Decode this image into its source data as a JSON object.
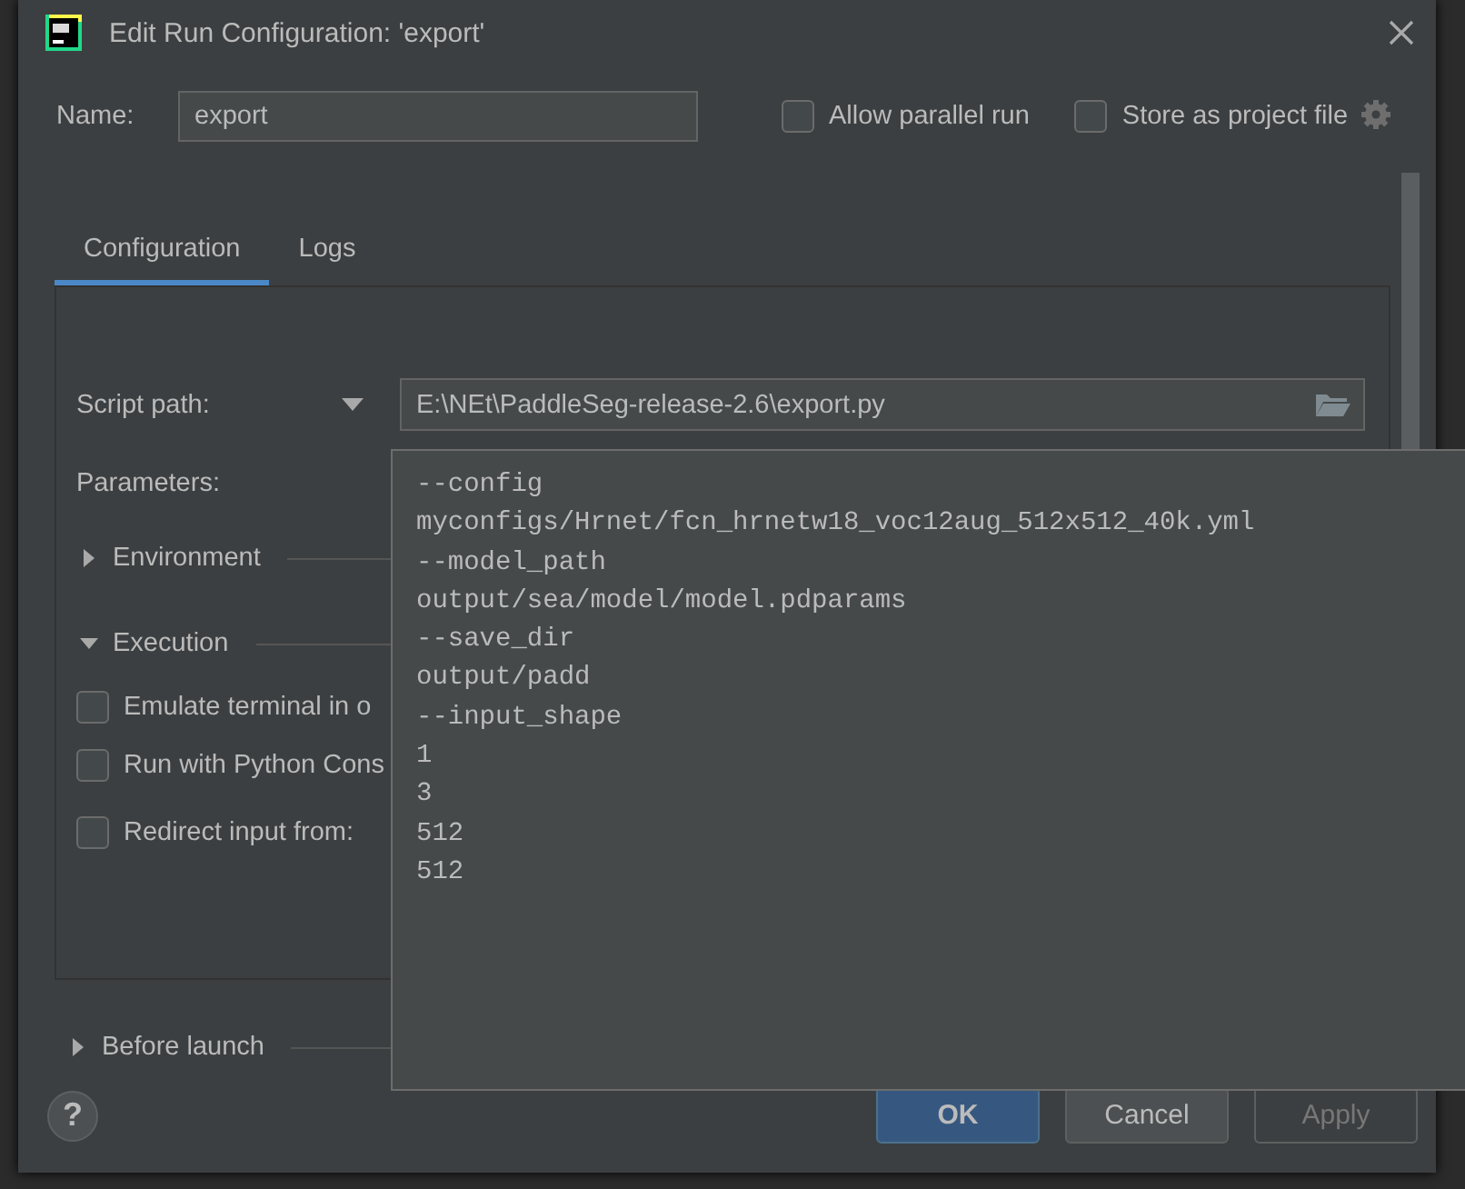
{
  "window": {
    "title": "Edit Run Configuration: 'export'"
  },
  "name": {
    "label": "Name:",
    "value": "export"
  },
  "options": [
    {
      "label": "Allow parallel run",
      "checked": false
    },
    {
      "label": "Store as project file",
      "checked": false
    }
  ],
  "tabs": [
    {
      "label": "Configuration",
      "selected": true
    },
    {
      "label": "Logs",
      "selected": false
    }
  ],
  "script_path": {
    "label": "Script path:",
    "value": "E:\\NEt\\PaddleSeg-release-2.6\\export.py"
  },
  "parameters": {
    "label": "Parameters:"
  },
  "sections": [
    {
      "label": "Environment",
      "expanded": false
    },
    {
      "label": "Execution",
      "expanded": true,
      "options": [
        {
          "label": "Emulate terminal in o",
          "checked": false
        },
        {
          "label": "Run with Python Cons",
          "checked": false
        },
        {
          "label": "Redirect input from:",
          "checked": false
        }
      ]
    }
  ],
  "before_launch": {
    "label": "Before launch",
    "expanded": false
  },
  "parameters_popup": {
    "lines": [
      "--config",
      "myconfigs/Hrnet/fcn_hrnetw18_voc12aug_512x512_40k.yml",
      "--model_path",
      "output/sea/model/model.pdparams",
      "--save_dir",
      "output/padd",
      "--input_shape",
      "1",
      "3",
      "512",
      "512"
    ]
  },
  "help": {
    "label": "?"
  },
  "buttons": [
    {
      "label": "OK",
      "kind": "primary",
      "disabled": false
    },
    {
      "label": "Cancel",
      "kind": "normal",
      "disabled": false
    },
    {
      "label": "Apply",
      "kind": "normal",
      "disabled": true
    }
  ]
}
